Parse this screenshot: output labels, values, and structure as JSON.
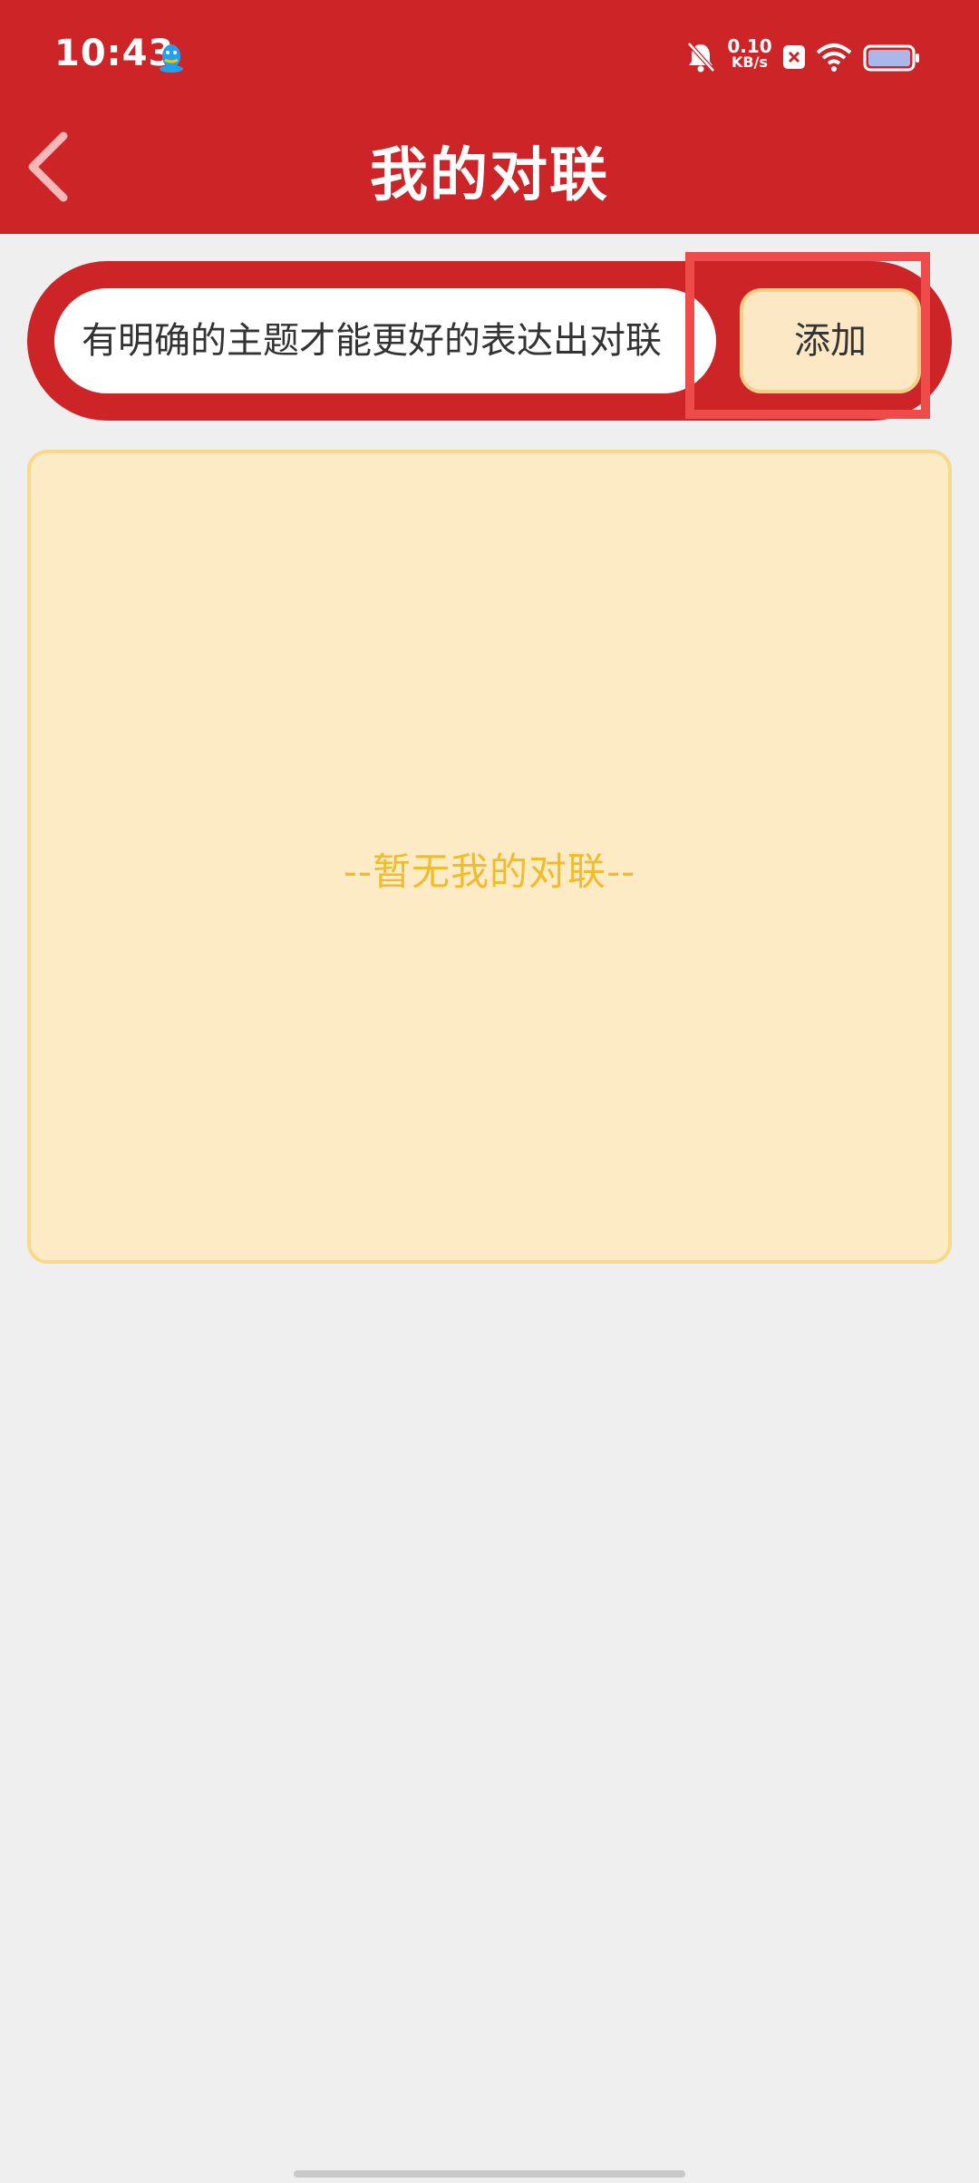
{
  "status_bar": {
    "time": "10:43",
    "net_speed_value": "0.10",
    "net_speed_unit": "KB/s",
    "icons": [
      "qq-icon",
      "bell-muted-icon",
      "sim-icon",
      "wifi-icon",
      "battery-icon"
    ]
  },
  "header": {
    "title": "我的对联",
    "back_icon": "chevron-left-icon"
  },
  "input_bar": {
    "value": "有明确的主题才能更好的表达出对联",
    "add_label": "添加"
  },
  "couplet_list": {
    "empty_text": "--暂无我的对联--"
  },
  "colors": {
    "header_red": "#cc2427",
    "card_bg": "#fdebc6",
    "empty_text": "#f1bc2b",
    "highlight": "#ef4b4b"
  }
}
